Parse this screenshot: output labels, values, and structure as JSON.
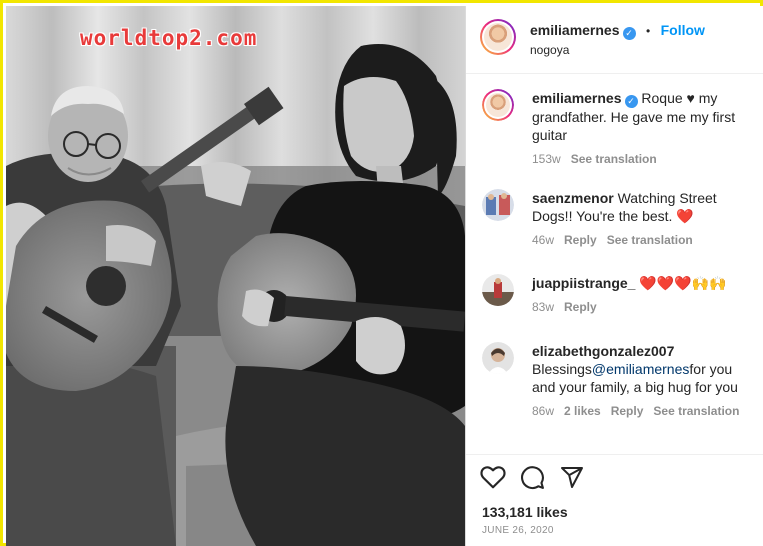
{
  "watermark": "worldtop2.com",
  "post": {
    "username": "emiliamernes",
    "follow_label": "Follow",
    "separator": "•",
    "location": "nogoya",
    "caption": "Roque ♥ my grandfather. He gave me my first guitar",
    "caption_age": "153w",
    "see_translation": "See translation",
    "likes": "133,181 likes",
    "date": "JUNE 26, 2020"
  },
  "comments": [
    {
      "username": "saenzmenor",
      "text": "Watching Street Dogs!! You're the best. ❤️",
      "age": "46w",
      "reply": "Reply",
      "see_translation": "See translation"
    },
    {
      "username": "juappiistrange_",
      "text": "❤️❤️❤️🙌🙌",
      "age": "83w",
      "reply": "Reply"
    },
    {
      "username": "elizabethgonzalez007",
      "text_before": "Blessings",
      "mention": "@emiliamernes",
      "text_after": "for you and your family, a big hug for you",
      "age": "86w",
      "likes": "2 likes",
      "reply": "Reply",
      "see_translation": "See translation"
    }
  ],
  "icons": {
    "like": "heart-outline-icon",
    "comment": "speech-bubble-icon",
    "share": "paper-plane-icon",
    "verified": "verified-badge-icon"
  },
  "colors": {
    "frame_border": "#f2e600",
    "link_blue": "#0095f6",
    "verified_blue": "#3897f0",
    "watermark_red": "#e83a3a",
    "heart_red": "#ed4956"
  }
}
